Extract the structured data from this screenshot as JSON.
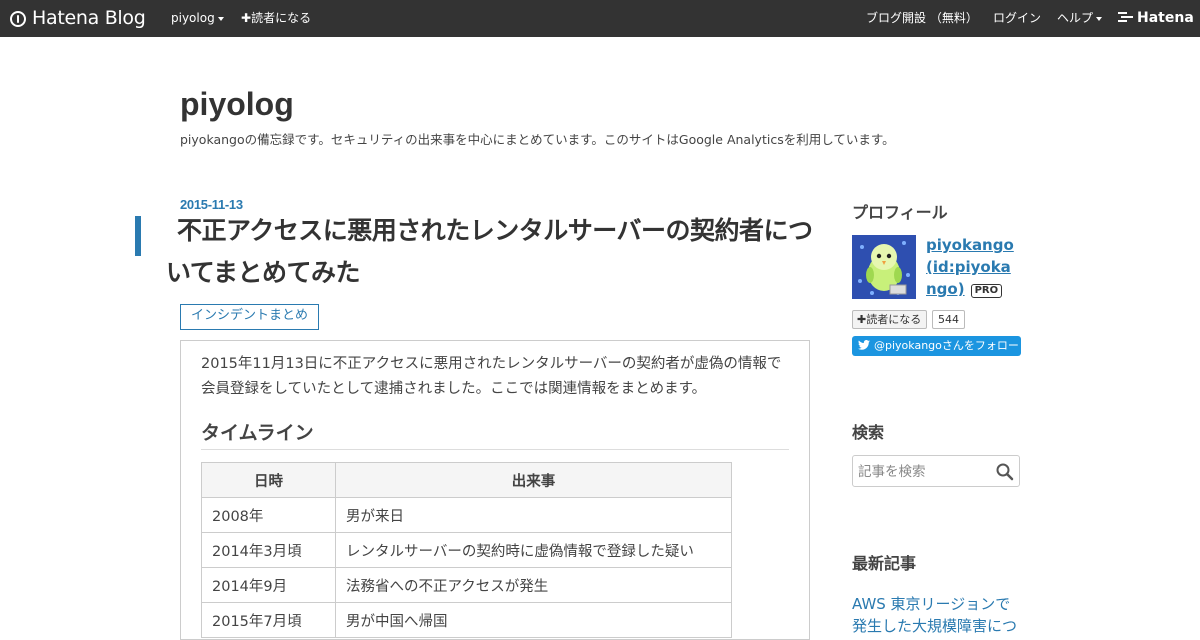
{
  "header": {
    "logo": "Hatena Blog",
    "blog_menu": "piyolog",
    "subscribe": "読者になる",
    "open_blog": "ブログ開設 （無料）",
    "login": "ログイン",
    "help": "ヘルプ",
    "hatena": "Hatena",
    "background_color": "#333333"
  },
  "blog": {
    "title": "piyolog",
    "description": "piyokangoの備忘録です。セキュリティの出来事を中心にまとめています。このサイトはGoogle Analyticsを利用しています。"
  },
  "entry": {
    "date": "2015-11-13",
    "title": "不正アクセスに悪用されたレンタルサーバーの契約者についてまとめてみた",
    "category": "インシデントまとめ",
    "intro": "2015年11月13日に不正アクセスに悪用されたレンタルサーバーの契約者が虚偽の情報で会員登録をしていたとして逮捕されました。ここでは関連情報をまとめます。",
    "timeline_heading": "タイムライン",
    "table": {
      "headers": [
        "日時",
        "出来事"
      ],
      "rows": [
        [
          "2008年",
          "男が来日"
        ],
        [
          "2014年3月頃",
          "レンタルサーバーの契約時に虚偽情報で登録した疑い"
        ],
        [
          "2014年9月",
          "法務省への不正アクセスが発生"
        ],
        [
          "2015年7月頃",
          "男が中国へ帰国"
        ]
      ]
    },
    "accent_color": "#2a7ab0"
  },
  "sidebar": {
    "profile": {
      "heading": "プロフィール",
      "name": "piyokango (id:piyokango)",
      "badge": "PRO",
      "subscribe_label": "読者になる",
      "subscriber_count": "544",
      "twitter_follow": "@piyokangoさんをフォロー"
    },
    "search": {
      "heading": "検索",
      "placeholder": "記事を検索"
    },
    "recent": {
      "heading": "最新記事",
      "first_item": "AWS 東京リージョンで発生した大規模障害につ"
    }
  }
}
